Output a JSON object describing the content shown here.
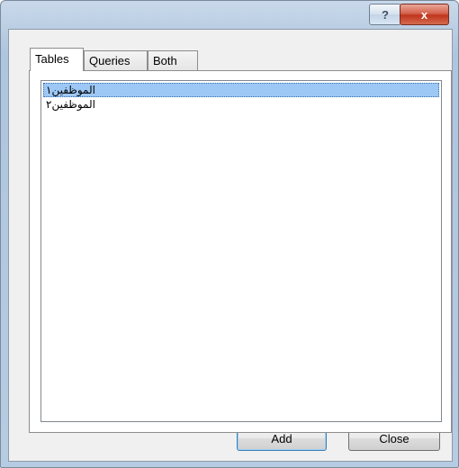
{
  "window": {
    "help_label": "?",
    "close_label": "x"
  },
  "tabs": [
    {
      "label": "Tables"
    },
    {
      "label": "Queries"
    },
    {
      "label": "Both"
    }
  ],
  "list": {
    "items": [
      {
        "label": "الموظفين١"
      },
      {
        "label": "الموظفين٢"
      }
    ],
    "selected_index": 0
  },
  "buttons": {
    "add_label": "Add",
    "close_label": "Close"
  }
}
